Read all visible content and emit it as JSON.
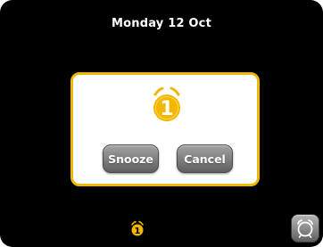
{
  "header": {
    "date": "Monday 12 Oct"
  },
  "alarm_dialog": {
    "alarm_number": "1",
    "snooze_label": "Snooze",
    "cancel_label": "Cancel",
    "icon": "alarm-bell-icon"
  },
  "status_bar": {
    "active_alarm_number": "1",
    "active_alarm_icon": "alarm-bell-icon",
    "alarm_button_icon": "alarm-clock-icon"
  },
  "colors": {
    "background": "#000000",
    "accent": "#f2b705",
    "dialog_background": "#ffffff",
    "button_gray": "#838383",
    "text_light": "#ffffff"
  }
}
